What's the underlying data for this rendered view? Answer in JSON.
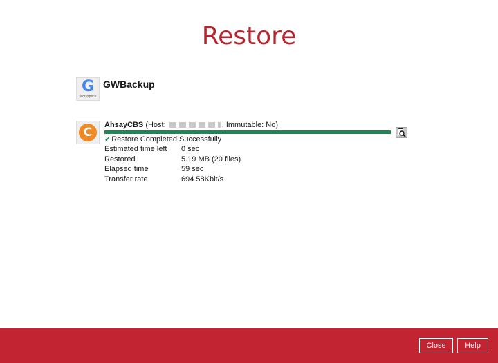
{
  "page": {
    "title": "Restore"
  },
  "backup_set": {
    "name": "GWBackup",
    "icon": "google-workspace-icon",
    "icon_letter": "G",
    "icon_caption": "Workspace"
  },
  "destination": {
    "icon": "ahsay-cbs-icon",
    "icon_letter": "C",
    "name": "AhsayCBS",
    "host_prefix": "(Host:",
    "host_value_masked": true,
    "host_suffix": ", Immutable: No)",
    "progress_fraction": 1.0,
    "status": "Restore Completed Successfully",
    "stats": [
      {
        "label": "Estimated time left",
        "value": "0 sec"
      },
      {
        "label": "Restored",
        "value": "5.19 MB (20 files)"
      },
      {
        "label": "Elapsed time",
        "value": "59 sec"
      },
      {
        "label": "Transfer rate",
        "value": "694.58Kbit/s"
      }
    ]
  },
  "footer": {
    "close_label": "Close",
    "help_label": "Help"
  },
  "colors": {
    "title": "#b5252e",
    "footer": "#c32431",
    "progress": "#1a8a55",
    "ahsay_orange": "#f08a24"
  }
}
